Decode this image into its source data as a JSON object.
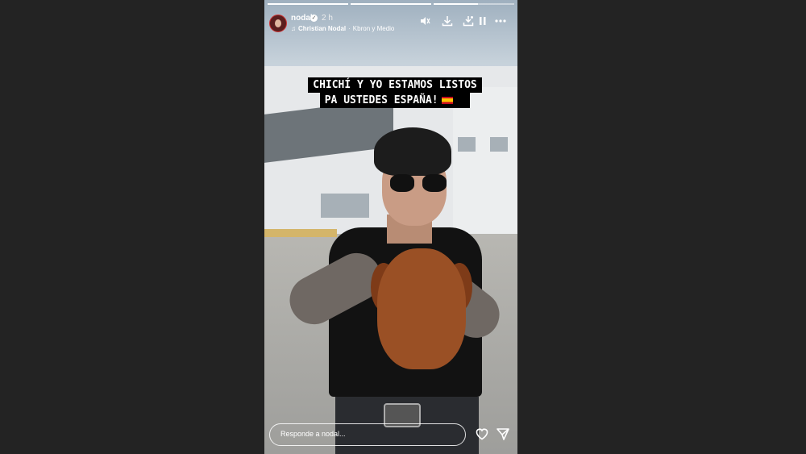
{
  "story": {
    "username": "nodal",
    "verified_icon": "verified-badge-icon",
    "time_ago": "2 h",
    "music": {
      "icon": "music-note-icon",
      "artist": "Christian Nodal",
      "song": "Kbron y Medio"
    },
    "progress": {
      "segments": 3,
      "current_index": 2,
      "current_fraction": 0.55
    },
    "controls": [
      "mute-icon",
      "download-icon",
      "save-icon",
      "pause-icon",
      "more-icon"
    ],
    "caption": {
      "line1": "CHICHÍ Y YO ESTAMOS LISTOS",
      "line2": "PA USTEDES ESPAÑA!",
      "emoji": "spain-flag"
    },
    "reply_placeholder": "Responde a nodal...",
    "actions": [
      "heart-icon",
      "send-icon"
    ]
  }
}
